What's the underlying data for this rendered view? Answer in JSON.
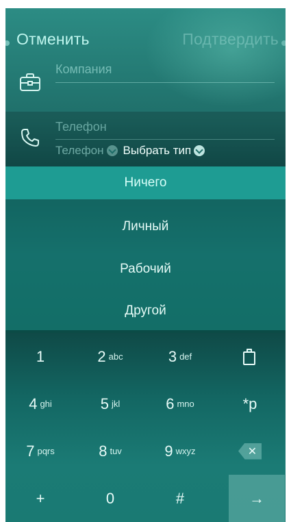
{
  "header": {
    "cancel_label": "Отменить",
    "confirm_label": "Подтвердить"
  },
  "company": {
    "placeholder": "Компания",
    "icon": "briefcase-icon"
  },
  "phone": {
    "placeholder": "Телефон",
    "type_label": "Телефон",
    "select_type_label": "Выбрать тип",
    "icon": "phone-icon"
  },
  "menu": {
    "options": [
      "Ничего",
      "Личный",
      "Рабочий",
      "Другой"
    ],
    "selected": "Ничего"
  },
  "keypad": {
    "rows": [
      [
        {
          "num": "1",
          "sub": ""
        },
        {
          "num": "2",
          "sub": "abc"
        },
        {
          "num": "3",
          "sub": "def"
        },
        {
          "icon": "paste-icon"
        }
      ],
      [
        {
          "num": "4",
          "sub": "ghi"
        },
        {
          "num": "5",
          "sub": "jkl"
        },
        {
          "num": "6",
          "sub": "mno"
        },
        {
          "num": "*p",
          "sub": ""
        }
      ],
      [
        {
          "num": "7",
          "sub": "pqrs"
        },
        {
          "num": "8",
          "sub": "tuv"
        },
        {
          "num": "9",
          "sub": "wxyz"
        },
        {
          "icon": "backspace-icon"
        }
      ],
      [
        {
          "num": "+",
          "sub": ""
        },
        {
          "num": "0",
          "sub": ""
        },
        {
          "num": "#",
          "sub": ""
        },
        {
          "icon": "enter-arrow-icon",
          "glyph": "→"
        }
      ]
    ]
  },
  "colors": {
    "accent": "#1e9c93",
    "background_top": "#2c8c84",
    "background_bottom": "#0f4c49"
  }
}
